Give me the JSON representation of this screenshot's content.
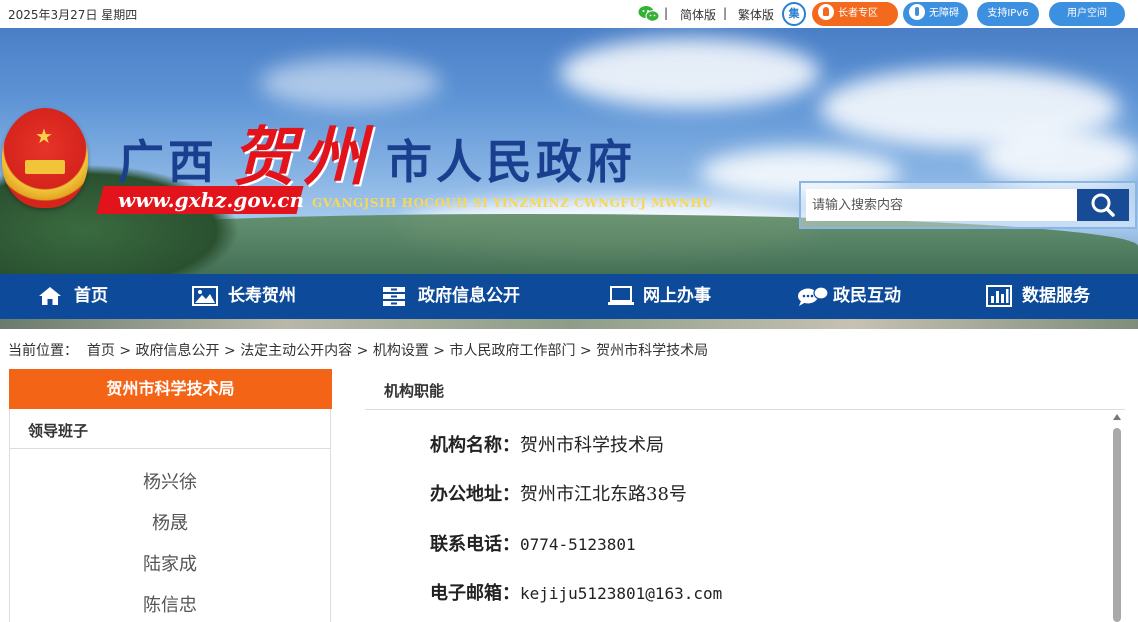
{
  "topbar": {
    "date": "2025年3月27日  星期四",
    "sep": "|",
    "simplified": "简体版",
    "traditional": "繁体版",
    "elder": "长者专区",
    "accessible": "无障碍",
    "ipv6": "支持IPv6",
    "user": "用户空间",
    "icons": [
      "wechat-icon",
      "ji-collect-icon",
      "elder-icon",
      "accessibility-icon"
    ],
    "colors": {
      "orange": "#f36a1e",
      "blue": "#3d8fe0"
    }
  },
  "banner": {
    "title_guangxi": "广西",
    "title_hezhou": "贺州",
    "title_rest": "市人民政府",
    "url": "www.gxhz.gov.cn",
    "pinyin": "GVANGJSIH  HOCOUH SI YINZMINZ CWNGFUJ MWNHU"
  },
  "search": {
    "placeholder": "请输入搜索内容"
  },
  "nav": [
    {
      "label": "首页",
      "icon": "home-icon"
    },
    {
      "label": "长寿贺州",
      "icon": "picture-icon"
    },
    {
      "label": "政府信息公开",
      "icon": "cabinet-icon"
    },
    {
      "label": "网上办事",
      "icon": "laptop-icon"
    },
    {
      "label": "政民互动",
      "icon": "chat-icon"
    },
    {
      "label": "数据服务",
      "icon": "chart-icon"
    }
  ],
  "breadcrumb": {
    "prefix": "当前位置：",
    "items": [
      "首页",
      "政府信息公开",
      "法定主动公开内容",
      "机构设置",
      "市人民政府工作部门",
      "贺州市科学技术局"
    ],
    "sep": ">"
  },
  "sidebar": {
    "title": "贺州市科学技术局",
    "section": "领导班子",
    "leaders": [
      "杨兴徐",
      "杨晟",
      "陆家成",
      "陈信忠"
    ]
  },
  "content": {
    "title": "机构职能",
    "rows": [
      {
        "key": "机构名称：",
        "value": "贺州市科学技术局"
      },
      {
        "key": "办公地址：",
        "value": "贺州市江北东路38号"
      },
      {
        "key": "联系电话：",
        "value": "0774-5123801"
      },
      {
        "key": "电子邮箱：",
        "value": "kejiju5123801@163.com"
      }
    ]
  }
}
